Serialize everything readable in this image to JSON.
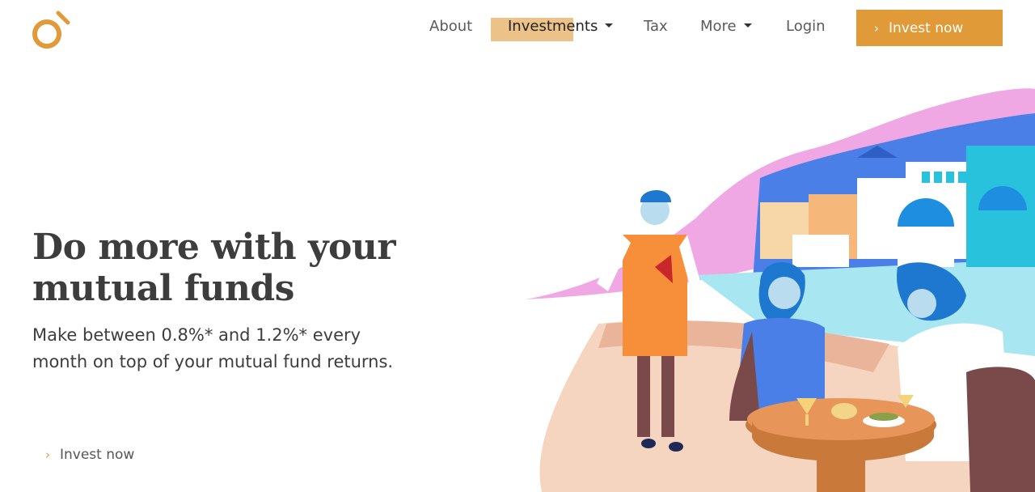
{
  "nav": {
    "about": "About",
    "investments": "Investments",
    "tax": "Tax",
    "more": "More",
    "login": "Login"
  },
  "header_cta": {
    "label": "Invest now",
    "icon": "chevron-right-icon"
  },
  "hero": {
    "title_line1": "Do more with your",
    "title_line2": "mutual funds",
    "subtitle": "Make between 0.8%* and 1.2%* every month on top of your mutual fund returns.",
    "cta_label": "Invest now"
  },
  "colors": {
    "accent": "#e09a38",
    "nav_highlight": "#edc288",
    "text": "#3d3d3d"
  }
}
